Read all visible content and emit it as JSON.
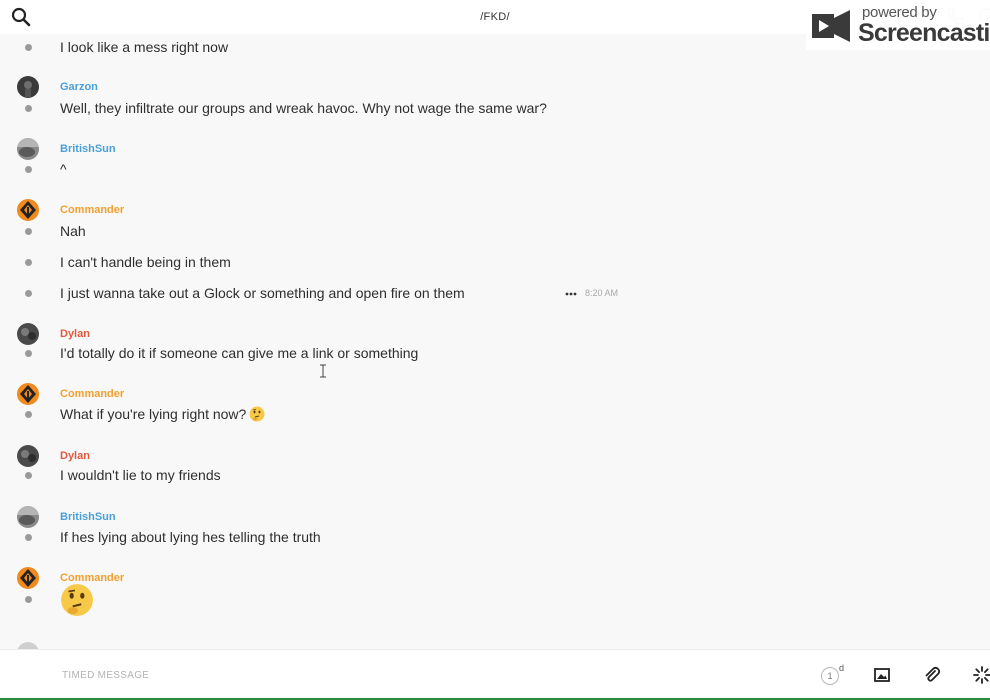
{
  "header": {
    "room_title": "/FKD/",
    "icons": [
      "search-icon",
      "phone-icon",
      "info-icon"
    ]
  },
  "watermark": {
    "line1": "powered by",
    "line2": "Screencastify"
  },
  "messages": {
    "m0": "I look like a mess right now",
    "g1_sender": "Garzon",
    "m1": "Well, they infiltrate our groups and wreak havoc. Why not wage the same war?",
    "g2_sender": "BritishSun",
    "m2": "^",
    "g3_sender": "Commander",
    "m3": "Nah",
    "m4": "I can't handle being in them",
    "m5": "I just wanna take out a Glock or something and open fire on them",
    "m5_time": "8:20 AM",
    "g4_sender": "Dylan",
    "m6": "I'd totally do it if someone can give me a link or something",
    "g5_sender": "Commander",
    "m7": "What if you're lying right now?",
    "m7_emoji": "thinking-face-emoji",
    "g6_sender": "Dylan",
    "m8": "I wouldn't lie to my friends",
    "g7_sender": "BritishSun",
    "m9": "If hes lying about lying hes telling the truth",
    "g8_sender": "Commander",
    "m10_emoji": "thinking-face-emoji"
  },
  "composer": {
    "placeholder": "TIMED MESSAGE",
    "timer_value": "1",
    "timer_unit": "d",
    "icons": [
      "timer-icon",
      "image-icon",
      "paperclip-icon",
      "loading-spinner-icon"
    ]
  },
  "colors": {
    "commander": "#f0a030",
    "britishsun": "#4a9fd8",
    "dylan": "#e05a3f",
    "garzon": "#4a9fd8",
    "bullet": "#9a9a9a",
    "background": "#f8f8f8"
  }
}
